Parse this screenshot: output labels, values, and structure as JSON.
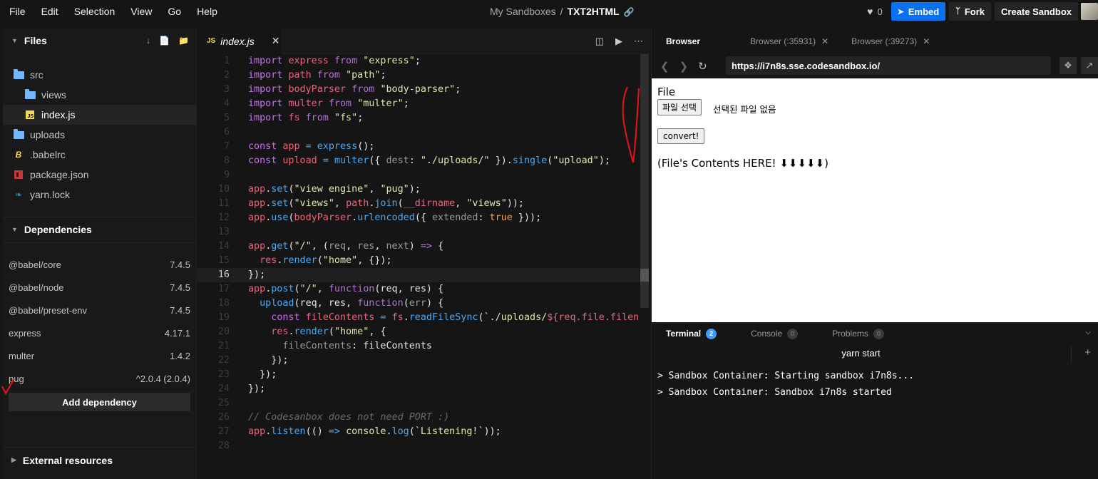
{
  "menubar": {
    "items": [
      "File",
      "Edit",
      "Selection",
      "View",
      "Go",
      "Help"
    ],
    "breadcrumb_parent": "My Sandboxes",
    "breadcrumb_sep": "/",
    "breadcrumb_current": "TXT2HTML",
    "likes": "0",
    "embed_label": "Embed",
    "fork_label": "Fork",
    "create_label": "Create Sandbox"
  },
  "sidebar": {
    "files_title": "Files",
    "tree": [
      {
        "label": "src",
        "icon": "folder-open-icon",
        "indent": 0
      },
      {
        "label": "views",
        "icon": "folder-icon",
        "indent": 1
      },
      {
        "label": "index.js",
        "icon": "js-file-icon",
        "indent": 1,
        "active": true
      },
      {
        "label": "uploads",
        "icon": "folder-icon",
        "indent": 0
      },
      {
        "label": ".babelrc",
        "icon": "babel-icon",
        "indent": 0
      },
      {
        "label": "package.json",
        "icon": "npm-icon",
        "indent": 0
      },
      {
        "label": "yarn.lock",
        "icon": "yarn-icon",
        "indent": 0
      }
    ],
    "dependencies_title": "Dependencies",
    "dependencies": [
      {
        "name": "@babel/core",
        "version": "7.4.5"
      },
      {
        "name": "@babel/node",
        "version": "7.4.5"
      },
      {
        "name": "@babel/preset-env",
        "version": "7.4.5"
      },
      {
        "name": "express",
        "version": "4.17.1"
      },
      {
        "name": "multer",
        "version": "1.4.2"
      },
      {
        "name": "pug",
        "version": "^2.0.4 (2.0.4)"
      }
    ],
    "add_dependency_label": "Add dependency",
    "external_title": "External resources"
  },
  "editor": {
    "tab_label": "index.js",
    "tab_badge": "JS",
    "current_line": 16,
    "lines": [
      [
        [
          "kw",
          "import"
        ],
        [
          "plain",
          " "
        ],
        [
          "var",
          "express"
        ],
        [
          "plain",
          " "
        ],
        [
          "fn",
          "from"
        ],
        [
          "plain",
          " "
        ],
        [
          "str",
          "\"express\""
        ],
        [
          "plain",
          ";"
        ]
      ],
      [
        [
          "kw",
          "import"
        ],
        [
          "plain",
          " "
        ],
        [
          "var",
          "path"
        ],
        [
          "plain",
          " "
        ],
        [
          "fn",
          "from"
        ],
        [
          "plain",
          " "
        ],
        [
          "str",
          "\"path\""
        ],
        [
          "plain",
          ";"
        ]
      ],
      [
        [
          "kw",
          "import"
        ],
        [
          "plain",
          " "
        ],
        [
          "var",
          "bodyParser"
        ],
        [
          "plain",
          " "
        ],
        [
          "fn",
          "from"
        ],
        [
          "plain",
          " "
        ],
        [
          "str",
          "\"body-parser\""
        ],
        [
          "plain",
          ";"
        ]
      ],
      [
        [
          "kw",
          "import"
        ],
        [
          "plain",
          " "
        ],
        [
          "var",
          "multer"
        ],
        [
          "plain",
          " "
        ],
        [
          "fn",
          "from"
        ],
        [
          "plain",
          " "
        ],
        [
          "str",
          "\"multer\""
        ],
        [
          "plain",
          ";"
        ]
      ],
      [
        [
          "kw",
          "import"
        ],
        [
          "plain",
          " "
        ],
        [
          "var",
          "fs"
        ],
        [
          "plain",
          " "
        ],
        [
          "fn",
          "from"
        ],
        [
          "plain",
          " "
        ],
        [
          "str",
          "\"fs\""
        ],
        [
          "plain",
          ";"
        ]
      ],
      [],
      [
        [
          "kw",
          "const"
        ],
        [
          "plain",
          " "
        ],
        [
          "var",
          "app"
        ],
        [
          "plain",
          " "
        ],
        [
          "call",
          "="
        ],
        [
          "plain",
          " "
        ],
        [
          "call",
          "express"
        ],
        [
          "plain",
          "();"
        ]
      ],
      [
        [
          "kw",
          "const"
        ],
        [
          "plain",
          " "
        ],
        [
          "var",
          "upload"
        ],
        [
          "plain",
          " "
        ],
        [
          "call",
          "="
        ],
        [
          "plain",
          " "
        ],
        [
          "call",
          "multer"
        ],
        [
          "plain",
          "({ "
        ],
        [
          "param",
          "dest"
        ],
        [
          "plain",
          ": "
        ],
        [
          "str",
          "\"./uploads/\""
        ],
        [
          "plain",
          " })."
        ],
        [
          "call",
          "single"
        ],
        [
          "plain",
          "("
        ],
        [
          "str",
          "\"upload\""
        ],
        [
          "plain",
          ");"
        ]
      ],
      [],
      [
        [
          "var",
          "app"
        ],
        [
          "plain",
          "."
        ],
        [
          "call",
          "set"
        ],
        [
          "plain",
          "("
        ],
        [
          "str",
          "\"view engine\""
        ],
        [
          "plain",
          ", "
        ],
        [
          "str",
          "\"pug\""
        ],
        [
          "plain",
          ");"
        ]
      ],
      [
        [
          "var",
          "app"
        ],
        [
          "plain",
          "."
        ],
        [
          "call",
          "set"
        ],
        [
          "plain",
          "("
        ],
        [
          "str",
          "\"views\""
        ],
        [
          "plain",
          ", "
        ],
        [
          "var",
          "path"
        ],
        [
          "plain",
          "."
        ],
        [
          "call",
          "join"
        ],
        [
          "plain",
          "("
        ],
        [
          "var",
          "__dirname"
        ],
        [
          "plain",
          ", "
        ],
        [
          "str",
          "\"views\""
        ],
        [
          "plain",
          "));"
        ]
      ],
      [
        [
          "var",
          "app"
        ],
        [
          "plain",
          "."
        ],
        [
          "call",
          "use"
        ],
        [
          "plain",
          "("
        ],
        [
          "var",
          "bodyParser"
        ],
        [
          "plain",
          "."
        ],
        [
          "call",
          "urlencoded"
        ],
        [
          "plain",
          "({ "
        ],
        [
          "param",
          "extended"
        ],
        [
          "plain",
          ": "
        ],
        [
          "bool",
          "true"
        ],
        [
          "plain",
          " }));"
        ]
      ],
      [],
      [
        [
          "var",
          "app"
        ],
        [
          "plain",
          "."
        ],
        [
          "call",
          "get"
        ],
        [
          "plain",
          "("
        ],
        [
          "str",
          "\"/\""
        ],
        [
          "plain",
          ", ("
        ],
        [
          "param",
          "req"
        ],
        [
          "plain",
          ", "
        ],
        [
          "param",
          "res"
        ],
        [
          "plain",
          ", "
        ],
        [
          "param",
          "next"
        ],
        [
          "plain",
          ") "
        ],
        [
          "kw",
          "=>"
        ],
        [
          "plain",
          " {"
        ]
      ],
      [
        [
          "plain",
          "  "
        ],
        [
          "var",
          "res"
        ],
        [
          "plain",
          "."
        ],
        [
          "call",
          "render"
        ],
        [
          "plain",
          "("
        ],
        [
          "str",
          "\"home\""
        ],
        [
          "plain",
          ", {});"
        ]
      ],
      [
        [
          "plain",
          "});"
        ]
      ],
      [
        [
          "var",
          "app"
        ],
        [
          "plain",
          "."
        ],
        [
          "call",
          "post"
        ],
        [
          "plain",
          "("
        ],
        [
          "str",
          "\"/\""
        ],
        [
          "plain",
          ", "
        ],
        [
          "fn",
          "function"
        ],
        [
          "plain",
          "(req, res) {"
        ]
      ],
      [
        [
          "plain",
          "  "
        ],
        [
          "call",
          "upload"
        ],
        [
          "plain",
          "(req, res, "
        ],
        [
          "fn",
          "function"
        ],
        [
          "plain",
          "("
        ],
        [
          "param",
          "err"
        ],
        [
          "plain",
          ") {"
        ]
      ],
      [
        [
          "plain",
          "    "
        ],
        [
          "kw",
          "const"
        ],
        [
          "plain",
          " "
        ],
        [
          "var",
          "fileContents"
        ],
        [
          "plain",
          " "
        ],
        [
          "call",
          "="
        ],
        [
          "plain",
          " "
        ],
        [
          "var",
          "fs"
        ],
        [
          "plain",
          "."
        ],
        [
          "call",
          "readFileSync"
        ],
        [
          "plain",
          "("
        ],
        [
          "str",
          "`./uploads/"
        ],
        [
          "var",
          "${req.file.filena"
        ]
      ],
      [
        [
          "plain",
          "    "
        ],
        [
          "var",
          "res"
        ],
        [
          "plain",
          "."
        ],
        [
          "call",
          "render"
        ],
        [
          "plain",
          "("
        ],
        [
          "str",
          "\"home\""
        ],
        [
          "plain",
          ", {"
        ]
      ],
      [
        [
          "plain",
          "      "
        ],
        [
          "param",
          "fileContents"
        ],
        [
          "plain",
          ": "
        ],
        [
          "plain",
          "fileContents"
        ]
      ],
      [
        [
          "plain",
          "    });"
        ]
      ],
      [
        [
          "plain",
          "  });"
        ]
      ],
      [
        [
          "plain",
          "});"
        ]
      ],
      [],
      [
        [
          "cmt",
          "// Codesanbox does not need PORT :)"
        ]
      ],
      [
        [
          "var",
          "app"
        ],
        [
          "plain",
          "."
        ],
        [
          "call",
          "listen"
        ],
        [
          "plain",
          "(() "
        ],
        [
          "call",
          "=>"
        ],
        [
          "plain",
          " "
        ],
        [
          "str",
          "console"
        ],
        [
          "plain",
          "."
        ],
        [
          "call",
          "log"
        ],
        [
          "plain",
          "("
        ],
        [
          "str",
          "`Listening!`"
        ],
        [
          "plain",
          "));"
        ]
      ],
      []
    ]
  },
  "preview": {
    "tabs": [
      {
        "label": "Browser",
        "active": true
      },
      {
        "label": "Browser (:35931)",
        "active": false
      },
      {
        "label": "Browser (:39273)",
        "active": false
      }
    ],
    "url": "https://i7n8s.sse.codesandbox.io/",
    "page": {
      "file_label": "File",
      "choose_file_button": "파일 선택",
      "no_file_text": "선택된 파일 없음",
      "convert_button": "convert!",
      "contents_text": "(File's Contents HERE! ⬇⬇⬇⬇⬇)"
    }
  },
  "terminal": {
    "tabs": [
      {
        "label": "Terminal",
        "count": "2",
        "active": true
      },
      {
        "label": "Console",
        "count": "0",
        "active": false
      },
      {
        "label": "Problems",
        "count": "0",
        "active": false
      }
    ],
    "command": "yarn start",
    "output": [
      "> Sandbox Container: Starting sandbox i7n8s...",
      "> Sandbox Container: Sandbox i7n8s started"
    ]
  },
  "colors": {
    "accent": "#0971f1",
    "annotation_red": "#e8141b"
  }
}
